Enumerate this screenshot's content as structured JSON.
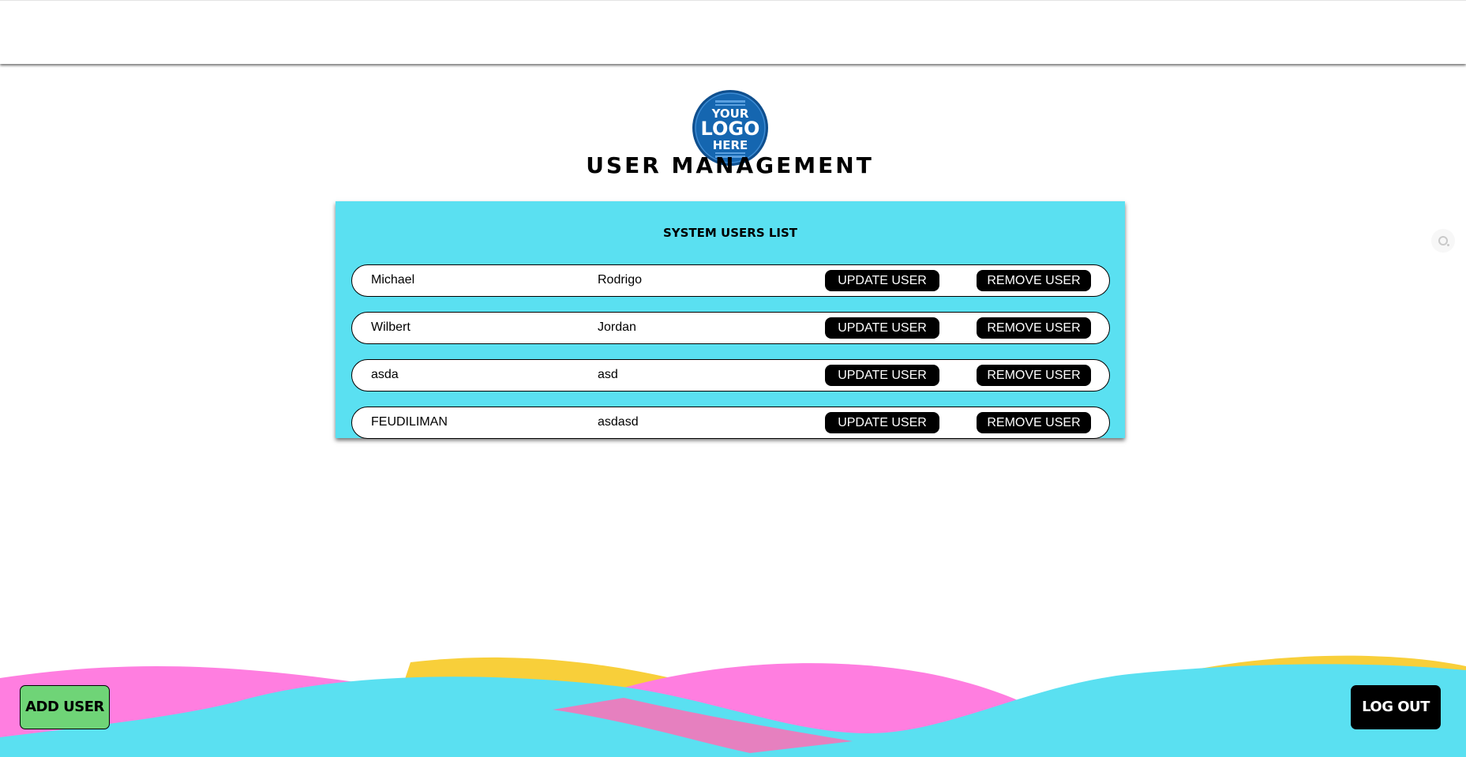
{
  "logo": {
    "lines": [
      "YOUR",
      "LOGO",
      "HERE"
    ],
    "icon": "your-logo-here-badge",
    "color": "#1566b0"
  },
  "page_title": "USER MANAGEMENT",
  "panel": {
    "title": "SYSTEM USERS LIST",
    "background": "#5ae0f1"
  },
  "users": [
    {
      "first": "Michael",
      "last": "Rodrigo",
      "update_label": "UPDATE USER",
      "remove_label": "REMOVE USER"
    },
    {
      "first": "Wilbert",
      "last": "Jordan",
      "update_label": "UPDATE USER",
      "remove_label": "REMOVE USER"
    },
    {
      "first": "asda",
      "last": "asd",
      "update_label": "UPDATE USER",
      "remove_label": "REMOVE USER"
    },
    {
      "first": "FEUDILIMAN",
      "last": "asdasd",
      "update_label": "UPDATE USER",
      "remove_label": "REMOVE USER"
    }
  ],
  "side_widget": {
    "icon": "search-icon"
  },
  "footer": {
    "add_user_label": "ADD USER",
    "logout_label": "LOG OUT",
    "wave_colors": [
      "#ff7ee0",
      "#f8cf3a",
      "#5ae0f1"
    ]
  },
  "colors": {
    "accent_cyan": "#5ae0f1",
    "add_button_green": "#6fd477",
    "button_black": "#000000"
  }
}
